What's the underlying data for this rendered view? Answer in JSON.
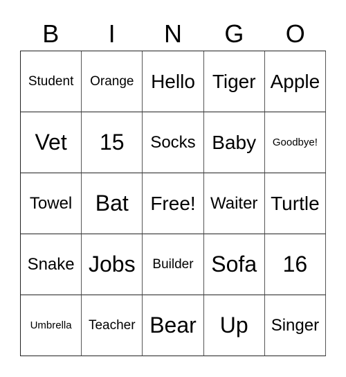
{
  "header": [
    "B",
    "I",
    "N",
    "G",
    "O"
  ],
  "cells": [
    [
      "Student",
      "Orange",
      "Hello",
      "Tiger",
      "Apple"
    ],
    [
      "Vet",
      "15",
      "Socks",
      "Baby",
      "Goodbye!"
    ],
    [
      "Towel",
      "Bat",
      "Free!",
      "Waiter",
      "Turtle"
    ],
    [
      "Snake",
      "Jobs",
      "Builder",
      "Sofa",
      "16"
    ],
    [
      "Umbrella",
      "Teacher",
      "Bear",
      "Up",
      "Singer"
    ]
  ]
}
